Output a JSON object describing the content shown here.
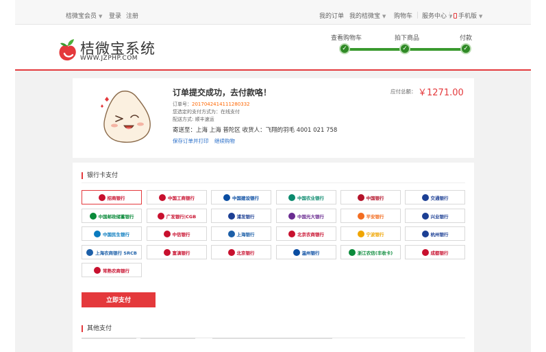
{
  "topbar": {
    "site_member": "桔微宝会员",
    "login": "登录",
    "register": "注册",
    "my_orders": "我的订单",
    "my_account": "我的桔微宝",
    "cart": "购物车",
    "service": "服务中心",
    "mobile": "手机版"
  },
  "logo": {
    "name": "桔微宝系统",
    "url": "WWW.JZPHP.COM"
  },
  "steps": [
    {
      "label": "查看购物车",
      "done": true
    },
    {
      "label": "拍下商品",
      "done": true
    },
    {
      "label": "付款",
      "done": true
    }
  ],
  "order": {
    "title": "订单提交成功，去付款咯！",
    "number_label": "订单号：",
    "number": "2017042414111280332",
    "pay_method": "您选定的支付方式为：在线支付",
    "ship_method": "配送方式: 顺丰速运",
    "address": "寄送至：上海 上海 普陀区  收货人：飞翔的羽毛  4001 021 758",
    "save_print": "保存订单并打印",
    "continue_shopping": "继续购物",
    "amount_label": "应付总额：",
    "amount": "￥1271.00"
  },
  "bank_section": {
    "title": "银行卡支付",
    "banks": [
      {
        "name": "招商银行",
        "color": "#c8102e",
        "selected": true
      },
      {
        "name": "中国工商银行",
        "color": "#c8102e"
      },
      {
        "name": "中国建设银行",
        "color": "#0a4da2"
      },
      {
        "name": "中国农业银行",
        "color": "#0b8a6e"
      },
      {
        "name": "中国银行",
        "color": "#b4132a"
      },
      {
        "name": "交通银行",
        "color": "#1c3f94"
      },
      {
        "name": "中国邮政储蓄银行",
        "color": "#0a8a3a"
      },
      {
        "name": "广发银行|CGB",
        "color": "#c8102e"
      },
      {
        "name": "浦发银行",
        "color": "#1c3f94"
      },
      {
        "name": "中国光大银行",
        "color": "#6a2c91"
      },
      {
        "name": "平安银行",
        "color": "#f26d21"
      },
      {
        "name": "兴业银行",
        "color": "#1c3f94"
      },
      {
        "name": "中国民生银行",
        "color": "#0a7bbf"
      },
      {
        "name": "中信银行",
        "color": "#c8102e"
      },
      {
        "name": "上海银行",
        "color": "#1c5fa8"
      },
      {
        "name": "北京农商银行",
        "color": "#c8102e"
      },
      {
        "name": "宁波银行",
        "color": "#f0a500"
      },
      {
        "name": "杭州银行",
        "color": "#1c3f94"
      },
      {
        "name": "上海农商银行 SRCB",
        "color": "#1c5fa8"
      },
      {
        "name": "富滇银行",
        "color": "#c8102e"
      },
      {
        "name": "北京银行",
        "color": "#c8102e"
      },
      {
        "name": "温州银行",
        "color": "#0a4da2"
      },
      {
        "name": "浙江农信(丰收卡)",
        "color": "#0a8a3a"
      },
      {
        "name": "成都银行",
        "color": "#c8102e"
      },
      {
        "name": "常熟农商银行",
        "color": "#c8102e"
      }
    ],
    "pay_button": "立即支付"
  },
  "other_section": {
    "title": "其他支付"
  },
  "colors": {
    "accent": "#e4393c",
    "step_green": "#2f8a25",
    "link": "#2a6fc9",
    "order_no": "#ff6600"
  }
}
